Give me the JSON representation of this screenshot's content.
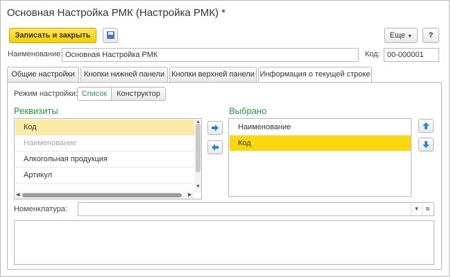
{
  "window": {
    "title": "Основная Настройка РМК (Настройка РМК) *"
  },
  "toolbar": {
    "save_close_label": "Записать и закрыть",
    "more_label": "Еще",
    "help_label": "?",
    "save_icon": "floppy-disk-icon"
  },
  "form": {
    "name_label": "Наименование:",
    "name_value": "Основная Настройка РМК",
    "code_label": "Код:",
    "code_value": "00-000001"
  },
  "tabs": [
    {
      "label": "Общие настройки"
    },
    {
      "label": "Кнопки нижней панели"
    },
    {
      "label": "Кнопки верхней панели"
    },
    {
      "label": "Информация о текущей строке"
    }
  ],
  "settings_mode": {
    "label": "Режим настройки:",
    "options": [
      "Список",
      "Конструктор"
    ],
    "selected": "Список"
  },
  "requisites": {
    "title": "Реквизиты",
    "items": [
      "Код",
      "Наименование",
      "Алкогольная продукция",
      "Артикул"
    ]
  },
  "selected_list": {
    "title": "Выбрано",
    "items": [
      "Наименование",
      "Код"
    ]
  },
  "nomenclature": {
    "label": "Номенклатура:",
    "value": ""
  },
  "colors": {
    "accent_yellow": "#f6cf00",
    "heading_green": "#1e9e3e",
    "arrow_blue": "#2f86d6"
  }
}
